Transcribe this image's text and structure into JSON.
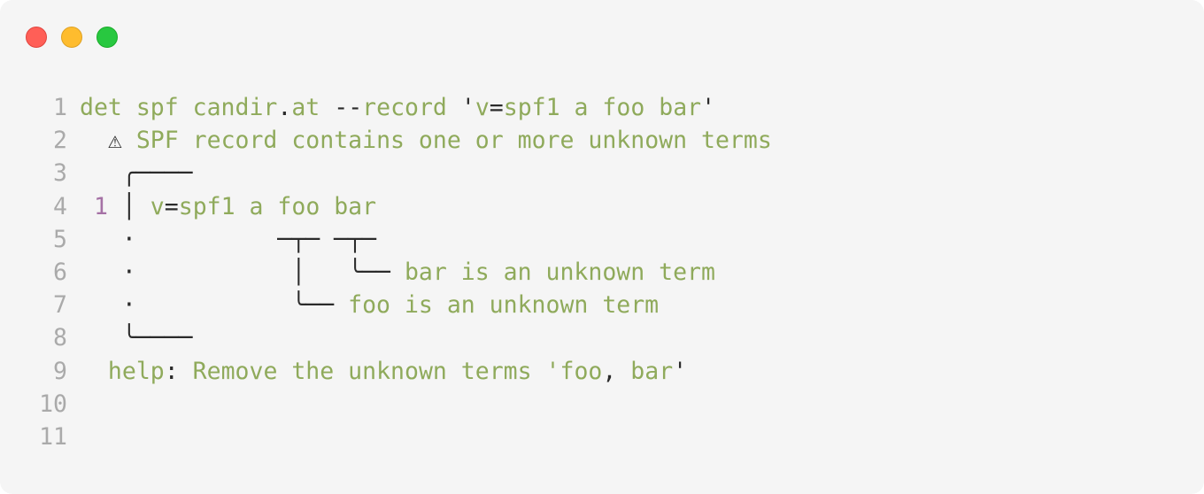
{
  "window": {
    "controls": [
      "close",
      "minimize",
      "maximize"
    ]
  },
  "lines": [
    {
      "num": "1",
      "segments": [
        {
          "t": "det spf candir",
          "c": "g"
        },
        {
          "t": ".",
          "c": "k"
        },
        {
          "t": "at",
          "c": "g"
        },
        {
          "t": " ",
          "c": "k"
        },
        {
          "t": "--",
          "c": "k"
        },
        {
          "t": "record",
          "c": "g"
        },
        {
          "t": " '",
          "c": "k"
        },
        {
          "t": "v",
          "c": "g"
        },
        {
          "t": "=",
          "c": "k"
        },
        {
          "t": "spf1 a foo bar",
          "c": "g"
        },
        {
          "t": "'",
          "c": "k"
        }
      ]
    },
    {
      "num": "2",
      "segments": [
        {
          "t": "  ",
          "c": "k"
        },
        {
          "t": "⚠",
          "c": "k"
        },
        {
          "t": " SPF record contains one or more unknown terms",
          "c": "g"
        }
      ]
    },
    {
      "num": "3",
      "segments": [
        {
          "t": "   ╭────",
          "c": "k"
        }
      ]
    },
    {
      "num": "4",
      "segments": [
        {
          "t": " 1",
          "c": "p"
        },
        {
          "t": " │ ",
          "c": "k"
        },
        {
          "t": "v",
          "c": "g"
        },
        {
          "t": "=",
          "c": "k"
        },
        {
          "t": "spf1 a foo bar",
          "c": "g"
        }
      ]
    },
    {
      "num": "5",
      "segments": [
        {
          "t": "   ·          ─┬─ ─┬─",
          "c": "k"
        }
      ]
    },
    {
      "num": "6",
      "segments": [
        {
          "t": "   ·           │   ╰── ",
          "c": "k"
        },
        {
          "t": "bar is an unknown term",
          "c": "g"
        }
      ]
    },
    {
      "num": "7",
      "segments": [
        {
          "t": "   ·           ╰── ",
          "c": "k"
        },
        {
          "t": "foo is an unknown term",
          "c": "g"
        }
      ]
    },
    {
      "num": "8",
      "segments": [
        {
          "t": "   ╰────",
          "c": "k"
        }
      ]
    },
    {
      "num": "9",
      "segments": [
        {
          "t": "  ",
          "c": "k"
        },
        {
          "t": "help",
          "c": "g"
        },
        {
          "t": ": ",
          "c": "k"
        },
        {
          "t": "Remove the unknown terms '",
          "c": "g"
        },
        {
          "t": "foo",
          "c": "g"
        },
        {
          "t": ", ",
          "c": "k"
        },
        {
          "t": "bar",
          "c": "g"
        },
        {
          "t": "'",
          "c": "k"
        }
      ]
    },
    {
      "num": "10",
      "segments": []
    },
    {
      "num": "11",
      "segments": []
    }
  ]
}
